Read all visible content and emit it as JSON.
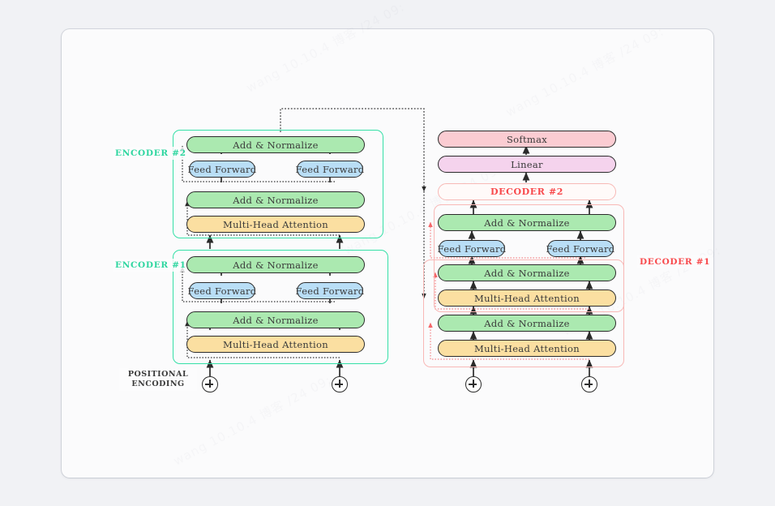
{
  "page": {
    "background": "#f1f2f5",
    "card_background": "#fbfbfc",
    "watermark_text": "wang 10.10.4 博客 /24 09:"
  },
  "colors": {
    "add_norm": "#abe9b0",
    "feed_forward": "#b9def6",
    "multi_head_attention": "#fbdfa1",
    "softmax": "#fbccd2",
    "linear": "#f5d3ed",
    "encoder_frame": "#35e0a7",
    "decoder_frame": "#f8b8b6",
    "encoder_label": "#2fd6a0",
    "decoder_label": "#f8494c",
    "wire": "#2b2b2b",
    "residual_wire": "#4a4a4a",
    "decoder_residual_wire": "#f88b8b"
  },
  "labels": {
    "encoder_2": "ENCODER #2",
    "encoder_1": "ENCODER #1",
    "decoder_2": "DECODER #2",
    "decoder_1": "DECODER  #1",
    "positional_encoding_line1": "POSITIONAL",
    "positional_encoding_line2": "ENCODING"
  },
  "nodes": {
    "add_normalize": "Add & Normalize",
    "feed_forward": "Feed Forward",
    "multi_head_attention": "Multi-Head Attention",
    "softmax": "Softmax",
    "linear": "Linear",
    "plus_icon": "plus-circle-icon"
  },
  "encoder_2": {
    "title": "ENCODER #2",
    "rows": [
      {
        "type": "add_normalize",
        "label": "Add & Normalize"
      },
      {
        "type": "feed_forward",
        "labels": [
          "Feed Forward",
          "Feed Forward"
        ]
      },
      {
        "type": "add_normalize",
        "label": "Add & Normalize"
      },
      {
        "type": "multi_head_attention",
        "label": "Multi-Head Attention"
      }
    ]
  },
  "encoder_1": {
    "title": "ENCODER #1",
    "rows": [
      {
        "type": "add_normalize",
        "label": "Add & Normalize"
      },
      {
        "type": "feed_forward",
        "labels": [
          "Feed Forward",
          "Feed Forward"
        ]
      },
      {
        "type": "add_normalize",
        "label": "Add & Normalize"
      },
      {
        "type": "multi_head_attention",
        "label": "Multi-Head Attention"
      }
    ],
    "inputs": [
      "plus-circle-icon",
      "plus-circle-icon"
    ]
  },
  "decoder_stack": {
    "top_nodes": [
      {
        "type": "softmax",
        "label": "Softmax"
      },
      {
        "type": "linear",
        "label": "Linear"
      },
      {
        "type": "decoder_2",
        "label": "DECODER #2"
      }
    ],
    "decoder_1": {
      "title": "DECODER  #1",
      "rows": [
        {
          "type": "add_normalize",
          "label": "Add & Normalize"
        },
        {
          "type": "feed_forward",
          "labels": [
            "Feed Forward",
            "Feed Forward"
          ]
        },
        {
          "type": "add_normalize",
          "label": "Add & Normalize"
        },
        {
          "type": "multi_head_attention",
          "label": "Multi-Head Attention"
        },
        {
          "type": "add_normalize",
          "label": "Add & Normalize"
        },
        {
          "type": "multi_head_attention",
          "label": "Multi-Head Attention"
        }
      ],
      "inputs": [
        "plus-circle-icon",
        "plus-circle-icon"
      ]
    }
  }
}
